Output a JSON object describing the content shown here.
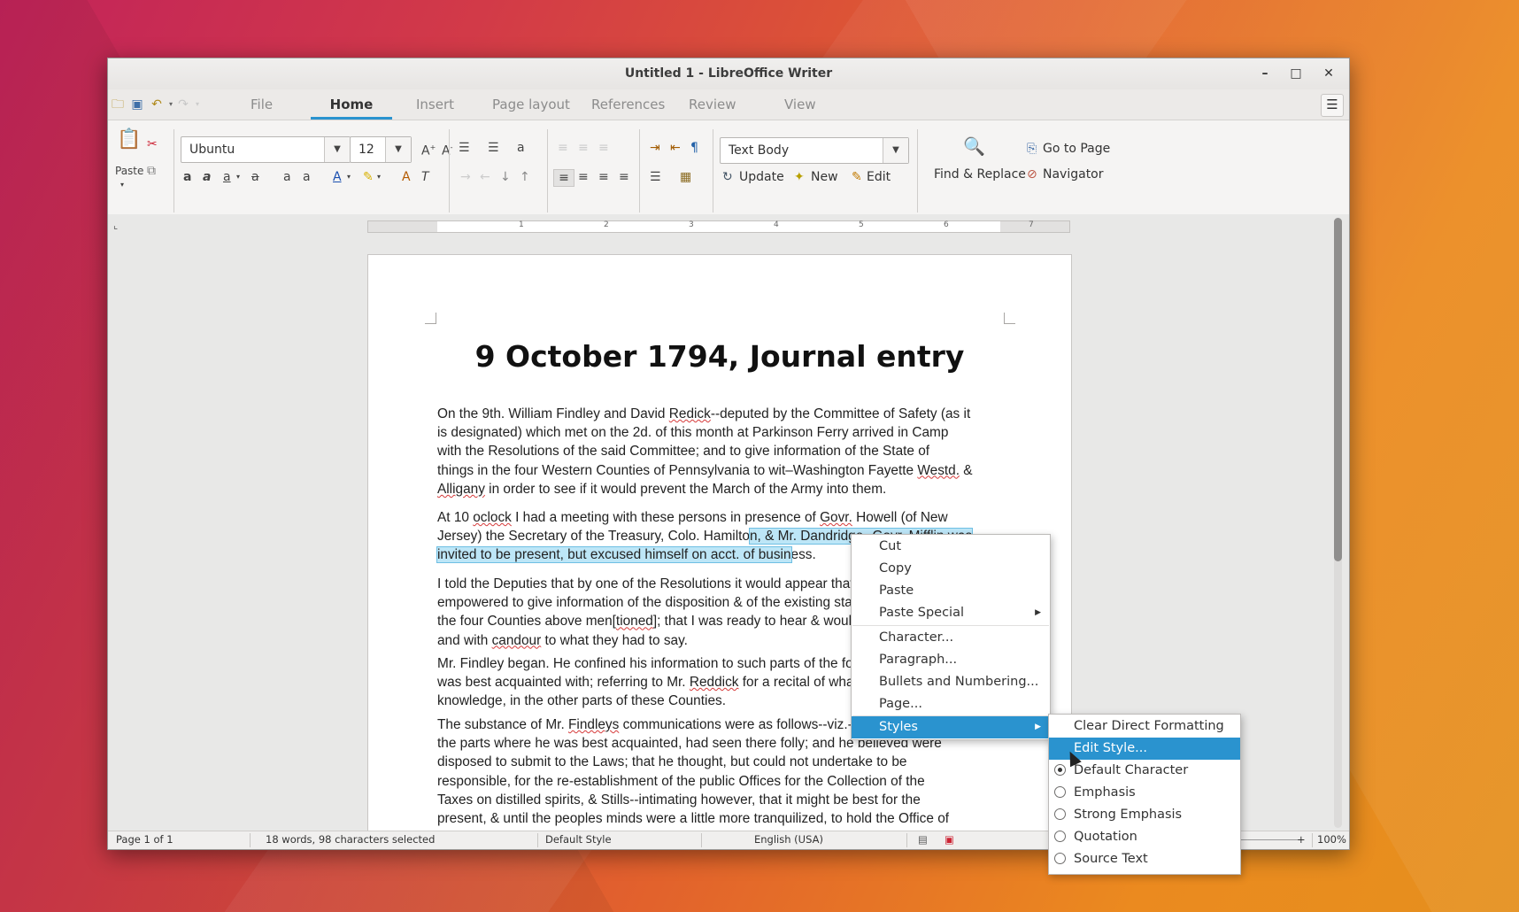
{
  "window": {
    "title": "Untitled 1 - LibreOffice Writer",
    "controls": [
      "–",
      "□",
      "✕"
    ]
  },
  "tabs": [
    "File",
    "Home",
    "Insert",
    "Page layout",
    "References",
    "Review",
    "View"
  ],
  "active_tab": "Home",
  "toolbar": {
    "paste_label": "Paste",
    "font_name": "Ubuntu",
    "font_size": "12",
    "paragraph_style": "Text Body",
    "update_label": "Update",
    "new_label": "New",
    "edit_label": "Edit",
    "find_replace_label": "Find & Replace",
    "goto_page_label": "Go to Page",
    "navigator_label": "Navigator"
  },
  "ruler_numbers": [
    "1",
    "2",
    "3",
    "4",
    "5",
    "6",
    "7"
  ],
  "document": {
    "title": "9 October 1794, Journal entry",
    "p1": [
      [
        {
          "t": "On the 9th. William Findley and David "
        },
        {
          "t": "Redick",
          "sq": true
        },
        {
          "t": "--deputed by the Committee of Safety (as it"
        }
      ],
      [
        {
          "t": "is designated) which met on the 2d. of this month at Parkinson Ferry arrived in Camp"
        }
      ],
      [
        {
          "t": "with the Resolutions of the said Committee; and to give information of the State of"
        }
      ],
      [
        {
          "t": "things in the four Western Counties of Pennsylvania to wit–Washington Fayette "
        },
        {
          "t": "Westd.",
          "sq": true
        },
        {
          "t": " &"
        }
      ],
      [
        {
          "t": "Alligany",
          "sq": true
        },
        {
          "t": " in order to see if it would prevent the March of the Army into them."
        }
      ]
    ],
    "p2": [
      [
        {
          "t": "At 10 "
        },
        {
          "t": "oclock",
          "sq": true
        },
        {
          "t": " I had a meeting with these persons in presence of "
        },
        {
          "t": "Govr.",
          "sq": true
        },
        {
          "t": " Howell (of New"
        }
      ],
      [
        {
          "t": "Jersey) the Secretary of the Treasury, Colo. Hamilto"
        },
        {
          "t": "n, & Mr. Dandridge--Govr. Mifflin was",
          "sel": true
        }
      ],
      [
        {
          "t": "invited to be present, but excused himself on acct. of busin",
          "sel": true
        },
        {
          "t": "ess."
        }
      ]
    ],
    "p3": [
      [
        {
          "t": "I told the Deputies that by one of the Resolutions it would appear that they were"
        }
      ],
      [
        {
          "t": "empowered to give information of the disposition & of the existing state of matters in"
        }
      ],
      [
        {
          "t": "the four Counties above men["
        },
        {
          "t": "tioned",
          "sq": true
        },
        {
          "t": "]; that I was ready to hear & would listen patiently,"
        }
      ],
      [
        {
          "t": "and with "
        },
        {
          "t": "candour",
          "sq": true
        },
        {
          "t": " to what they had to say."
        }
      ]
    ],
    "p4": [
      [
        {
          "t": "Mr. Findley began. He confined his information to such parts of the four Counties as he"
        }
      ],
      [
        {
          "t": "was best acquainted with; referring to Mr. "
        },
        {
          "t": "Reddick",
          "sq": true
        },
        {
          "t": " for a recital of what fell within his"
        }
      ],
      [
        {
          "t": "knowledge, in the other parts of these Counties."
        }
      ]
    ],
    "p5": [
      [
        {
          "t": "The substance of Mr. "
        },
        {
          "t": "Findleys",
          "sq": true
        },
        {
          "t": " communications were as follows--viz.--That the people in"
        }
      ],
      [
        {
          "t": "the parts where he was best acquainted, had seen there folly; and he believed were"
        }
      ],
      [
        {
          "t": "disposed to submit to the Laws; that he thought, but could not undertake to be"
        }
      ],
      [
        {
          "t": "responsible, for the re-establishment of the public Offices for the Collection of the"
        }
      ],
      [
        {
          "t": "Taxes on distilled spirits, & Stills--intimating however, that it might be best for the"
        }
      ],
      [
        {
          "t": "present, & until the peoples minds were a little more tranquilized, to hold the Office of"
        }
      ]
    ]
  },
  "statusbar": {
    "page": "Page 1 of 1",
    "words": "18 words, 98 characters selected",
    "style": "Default Style",
    "language": "English (USA)",
    "zoom": "100%",
    "zoom_minus": "−",
    "zoom_plus": "+"
  },
  "context_menu": {
    "items": [
      "Cut",
      "Copy",
      "Paste",
      "Paste Special",
      "Character...",
      "Paragraph...",
      "Bullets and Numbering...",
      "Page...",
      "Styles"
    ]
  },
  "styles_submenu": {
    "clear": "Clear Direct Formatting",
    "edit": "Edit Style...",
    "options": [
      "Default Character",
      "Emphasis",
      "Strong Emphasis",
      "Quotation",
      "Source Text"
    ],
    "selected_option": "Default Character"
  },
  "colors": {
    "accent": "#2a93cf",
    "selection": "#bde6f7"
  }
}
